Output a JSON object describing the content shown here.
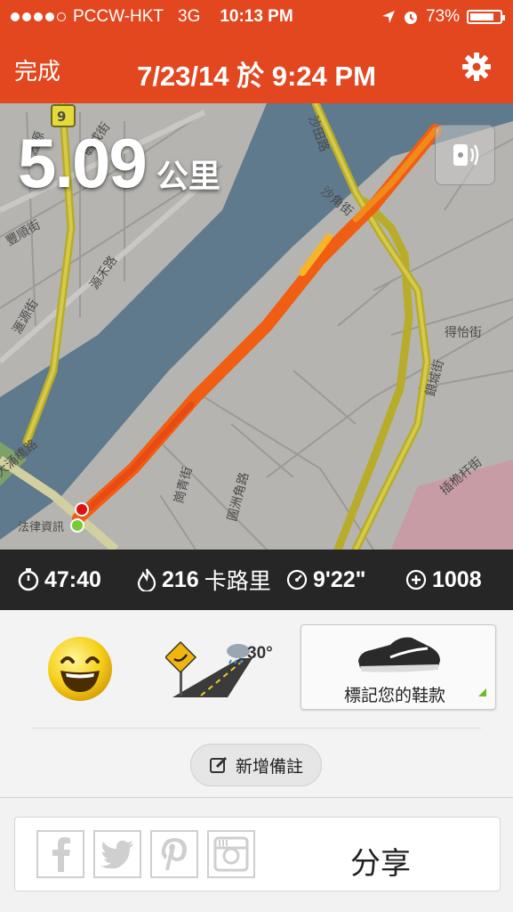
{
  "status_bar": {
    "carrier": "PCCW-HKT",
    "network": "3G",
    "time": "10:13 PM",
    "battery": "73%",
    "battery_level": 0.73
  },
  "nav": {
    "done_label": "完成",
    "title": "7/23/14 於 9:24 PM",
    "settings_icon": "gear-icon"
  },
  "map": {
    "distance_value": "5.09",
    "distance_unit": "公里",
    "labels": {
      "route_9": "9",
      "shatin_road": "沙田路",
      "sha_tin_wai": "沙角街",
      "kwai_tai": "豐順街",
      "yuen_wo": "源禾路",
      "yuen_chau": "滙源街",
      "tak_yi": "得怡街",
      "ngan_shing": "銀城街",
      "sha_tin_centre": "插桅杆街",
      "tai_po": "圓洲角路",
      "shek_mun": "崗青街",
      "law_courts": "法律資訊",
      "tak_wing": "大涌橋路",
      "sha_kok": "毓成街",
      "mei_tin": "瀝源"
    }
  },
  "stats": {
    "duration": "47:40",
    "calories_value": "216",
    "calories_label": "卡路里",
    "pace": "9'22\"",
    "fuel": "1008"
  },
  "panel": {
    "mood_icon": "happy-face-icon",
    "terrain_icon": "road-terrain-icon",
    "temperature": "30°",
    "shoe_label": "標記您的鞋款",
    "note_label": "新增備註"
  },
  "share": {
    "label": "分享",
    "icons": [
      "facebook-icon",
      "twitter-icon",
      "pinterest-icon",
      "instagram-icon"
    ]
  },
  "colors": {
    "accent": "#e2471f",
    "route": "#f06a1a",
    "stats_bg": "#262626",
    "water": "#5f7a8c"
  }
}
